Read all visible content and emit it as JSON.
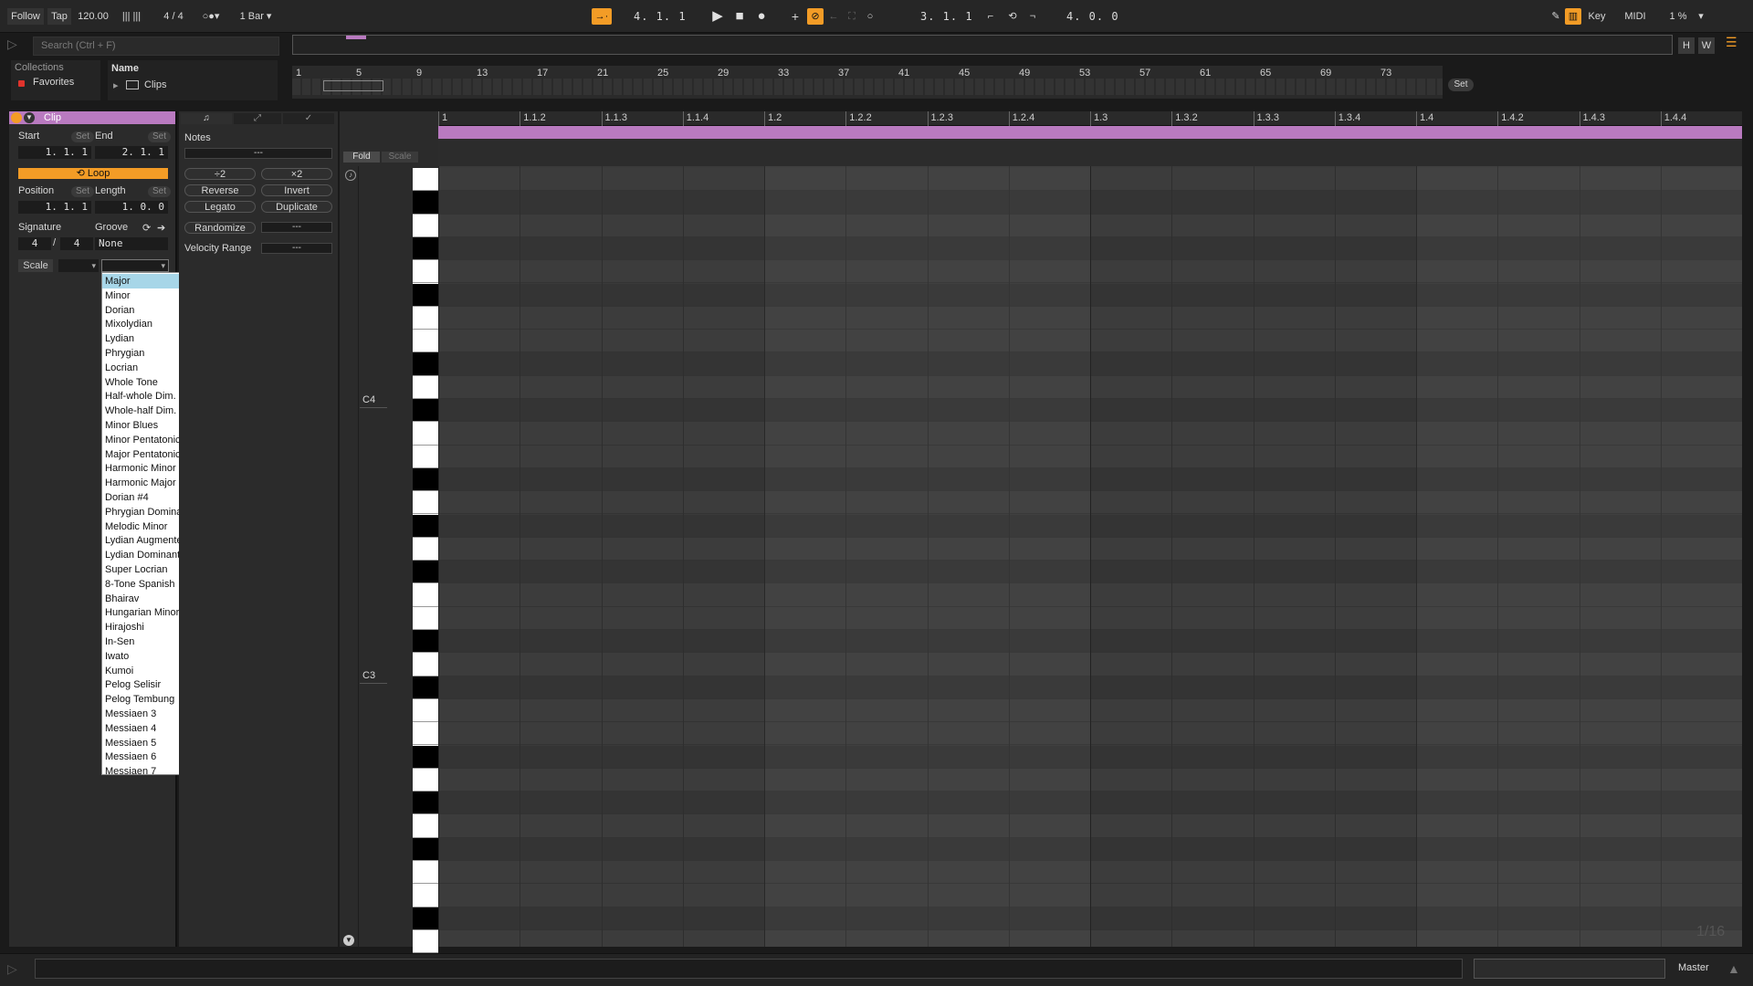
{
  "transport": {
    "follow": "Follow",
    "tap": "Tap",
    "tempo": "120.00",
    "time_sig": "4 / 4",
    "quantize": "1 Bar",
    "arrangement_position": "4.  1.  1",
    "loop_start": "3.  1.  1",
    "loop_length": "4.  0.  0",
    "key_label": "Key",
    "midi_label": "MIDI",
    "cpu": "1 %"
  },
  "browser": {
    "search_placeholder": "Search (Ctrl + F)",
    "collections_header": "Collections",
    "favorites": "Favorites",
    "name_header": "Name",
    "clips_folder": "Clips"
  },
  "arrangement": {
    "bar_numbers": [
      "1",
      "5",
      "9",
      "13",
      "17",
      "21",
      "25",
      "29",
      "33",
      "37",
      "41",
      "45",
      "49",
      "53",
      "57",
      "61",
      "65",
      "69",
      "73"
    ],
    "h_button": "H",
    "w_button": "W",
    "set_button": "Set"
  },
  "clip": {
    "title": "Clip",
    "start_label": "Start",
    "end_label": "End",
    "set": "Set",
    "start_value": "1.   1.   1",
    "end_value": "2.   1.   1",
    "loop_label": "Loop",
    "position_label": "Position",
    "length_label": "Length",
    "position_value": "1.   1.   1",
    "length_value": "1.   0.   0",
    "signature_label": "Signature",
    "groove_label": "Groove",
    "sig_num": "4",
    "sig_slash": "/",
    "sig_den": "4",
    "groove_value": "None",
    "scale_label": "Scale"
  },
  "notes": {
    "header": "Notes",
    "value_field": "---",
    "div2": "÷2",
    "mul2": "×2",
    "reverse": "Reverse",
    "invert": "Invert",
    "legato": "Legato",
    "duplicate": "Duplicate",
    "randomize": "Randomize",
    "randomize_value": "---",
    "velocity_range_label": "Velocity Range",
    "velocity_range_value": "---"
  },
  "pianoroll": {
    "fold": "Fold",
    "scale": "Scale",
    "c4": "C4",
    "c3": "C3",
    "grid_label": "1/16",
    "ruler_labels": [
      "1",
      "1.1.2",
      "1.1.3",
      "1.1.4",
      "1.2",
      "1.2.2",
      "1.2.3",
      "1.2.4",
      "1.3",
      "1.3.2",
      "1.3.3",
      "1.3.4",
      "1.4",
      "1.4.2",
      "1.4.3",
      "1.4.4"
    ]
  },
  "scale_dropdown": {
    "selected": "Major",
    "options": [
      "Major",
      "Minor",
      "Dorian",
      "Mixolydian",
      "Lydian",
      "Phrygian",
      "Locrian",
      "Whole Tone",
      "Half-whole Dim.",
      "Whole-half Dim.",
      "Minor Blues",
      "Minor Pentatonic",
      "Major Pentatonic",
      "Harmonic Minor",
      "Harmonic Major",
      "Dorian #4",
      "Phrygian Dominant",
      "Melodic Minor",
      "Lydian Augmented",
      "Lydian Dominant",
      "Super Locrian",
      "8-Tone Spanish",
      "Bhairav",
      "Hungarian Minor",
      "Hirajoshi",
      "In-Sen",
      "Iwato",
      "Kumoi",
      "Pelog Selisir",
      "Pelog Tembung",
      "Messiaen 3",
      "Messiaen 4",
      "Messiaen 5",
      "Messiaen 6",
      "Messiaen 7"
    ]
  },
  "bottom": {
    "master": "Master"
  },
  "colors": {
    "accent_orange": "#f39c26",
    "clip_purple": "#b97ac0",
    "selection_blue": "#a7d6e8"
  }
}
